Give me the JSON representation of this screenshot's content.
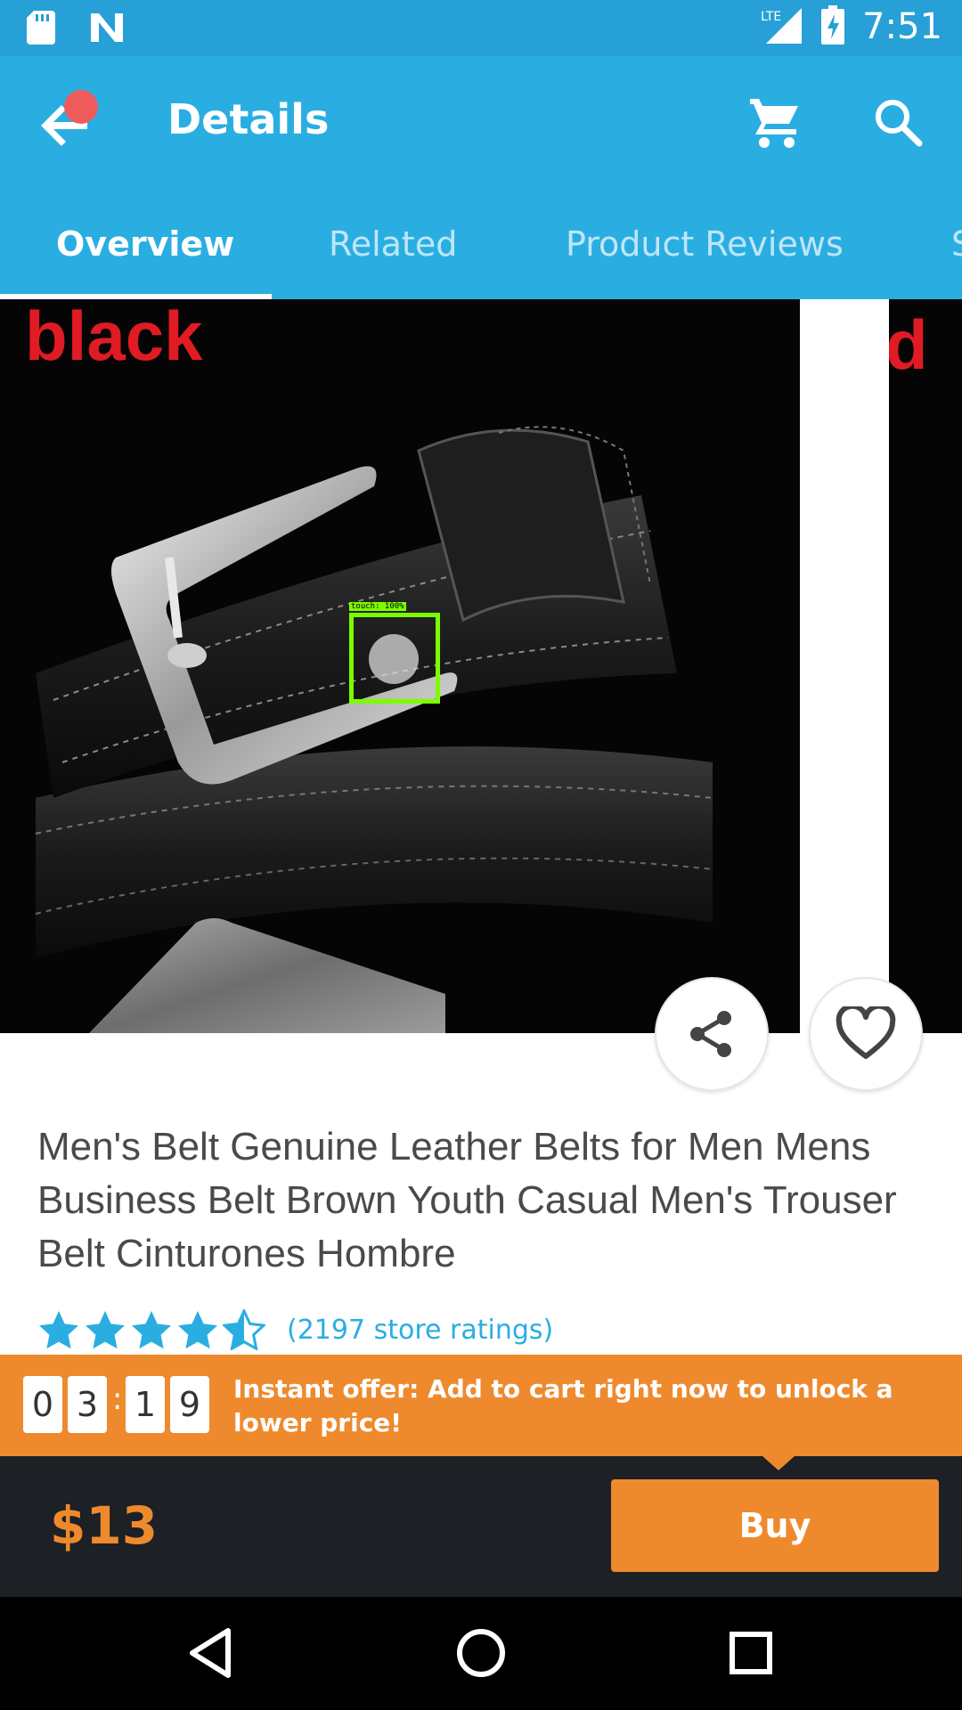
{
  "status_bar": {
    "time": "7:51",
    "network": "LTE",
    "icons": [
      "sd-card-icon",
      "n-notification-icon",
      "signal-icon",
      "battery-charging-icon"
    ]
  },
  "app_bar": {
    "title": "Details",
    "icons": [
      "back-arrow-icon",
      "cart-icon",
      "search-icon"
    ]
  },
  "tabs": [
    {
      "label": "Overview",
      "active": true
    },
    {
      "label": "Related",
      "active": false
    },
    {
      "label": "Product Reviews",
      "active": false
    },
    {
      "label": "S",
      "active": false
    }
  ],
  "gallery": {
    "main_color_label": "black",
    "next_color_label": "d",
    "touch_overlay_text": "touch: 100%"
  },
  "product": {
    "title": "Men's Belt Genuine Leather Belts for Men Mens Business Belt Brown Youth Casual Men's Trouser Belt Cinturones Hombre",
    "rating_stars": 4.5,
    "rating_text": "(2197 store ratings)"
  },
  "offer": {
    "timer_digits": [
      "0",
      "3",
      "1",
      "9"
    ],
    "text": "Instant offer: Add to cart right now to unlock a lower price!"
  },
  "buy_bar": {
    "price": "$13",
    "buy_label": "Buy"
  },
  "colors": {
    "primary": "#2aaee2",
    "accent": "#ee8a2d",
    "dark_bar": "#1d2024",
    "label_red": "#e01b24"
  }
}
